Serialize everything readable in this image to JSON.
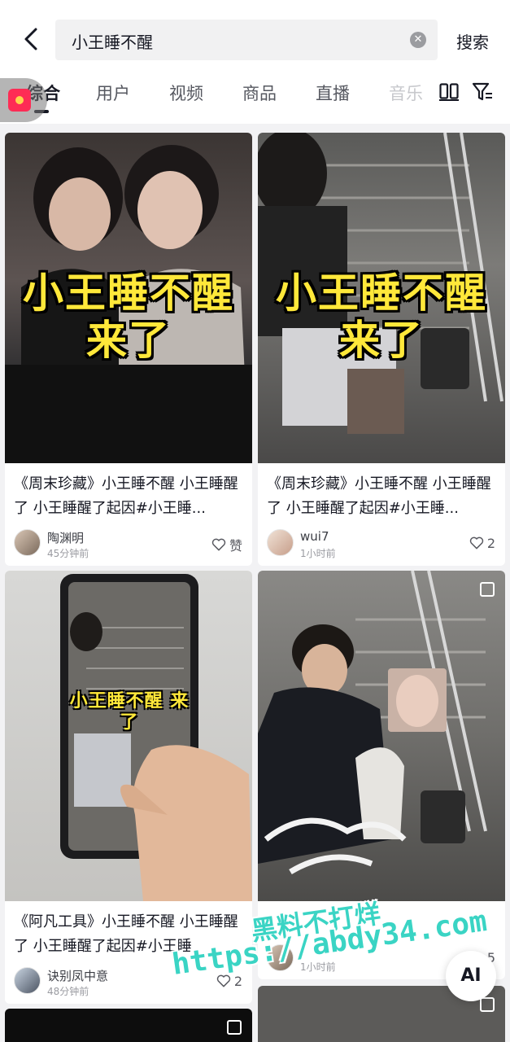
{
  "search": {
    "query": "小王睡不醒",
    "button_label": "搜索"
  },
  "tabs": [
    {
      "label": "综合"
    },
    {
      "label": "用户"
    },
    {
      "label": "视频"
    },
    {
      "label": "商品"
    },
    {
      "label": "直播"
    },
    {
      "label": "音乐"
    }
  ],
  "results": [
    {
      "overlay_text": "小王睡不醒 来了",
      "caption": "《周末珍藏》小王睡不醒 小王睡醒了 小王睡醒了起因#小王睡...",
      "author": "陶渊明",
      "time": "45分钟前",
      "likes": "赞"
    },
    {
      "overlay_text": "小王睡不醒 来了",
      "caption": "《周末珍藏》小王睡不醒 小王睡醒了 小王睡醒了起因#小王睡...",
      "author": "wui7",
      "time": "1小时前",
      "likes": "2"
    },
    {
      "overlay_text": "小王睡不醒 来了",
      "caption": "《阿凡工具》小王睡不醒 小王睡醒了 小王睡醒了起因#小王睡",
      "author": "诀别凤中意",
      "time": "48分钟前",
      "likes": "2"
    },
    {
      "caption": "",
      "author": "",
      "time": "1小时前",
      "likes": "5"
    }
  ],
  "watermark": {
    "line1": "黑料不打烊",
    "line2": "https://abdy34.com"
  },
  "ai_button": "AI",
  "colors": {
    "accent": "#fe2c55",
    "overlay_text": "#ffe83a",
    "watermark": "#3ad4c4"
  }
}
